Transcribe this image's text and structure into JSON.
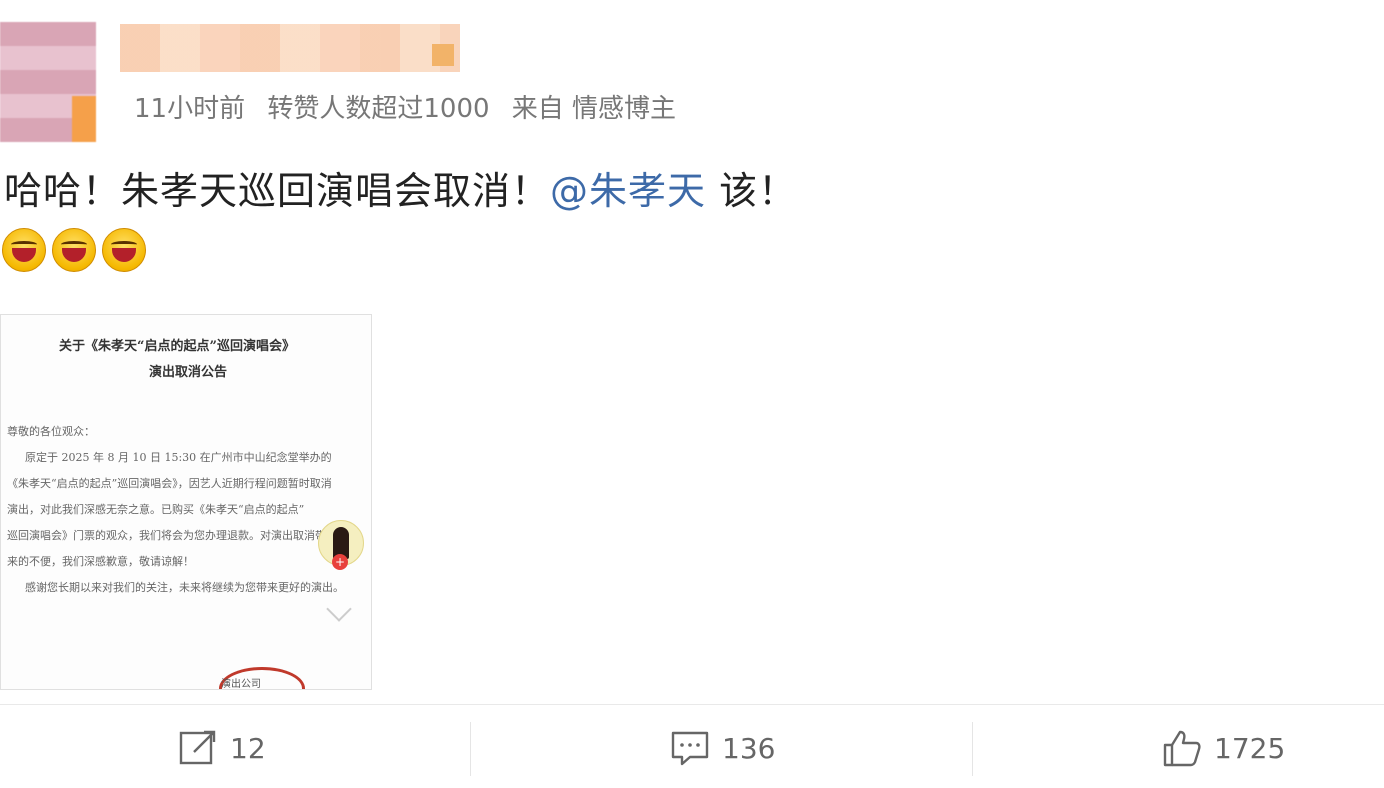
{
  "post": {
    "meta": {
      "time": "11小时前",
      "repost_note": "转赞人数超过1000",
      "source": "来自 情感博主"
    },
    "text_main": "哈哈！朱孝天巡回演唱会取消！",
    "mention": "@朱孝天",
    "text_tail": " 该！",
    "emojis": [
      "laugh-emoji",
      "laugh-emoji",
      "laugh-emoji"
    ]
  },
  "document": {
    "title_line1": "关于《朱孝天“启点的起点”巡回演唱会》",
    "title_line2": "演出取消公告",
    "lines": [
      "尊敬的各位观众：",
      "原定于 2025 年 8 月 10 日 15:30 在广州市中山纪念堂举办的",
      "《朱孝天“启点的起点”巡回演唱会》，因艺人近期行程问题暂时取消",
      "演出，对此我们深感无奈之意。已购买《朱孝天“启点的起点”",
      "巡回演唱会》门票的观众，我们将会为您办理退款。对演出取消带",
      "来的不便，我们深感歉意，敬请谅解！",
      "感谢您长期以来对我们的关注，未来将继续为您带来更好的演出。"
    ],
    "signature": "演出公司"
  },
  "actions": {
    "repost_count": "12",
    "comment_count": "136",
    "like_count": "1725"
  }
}
